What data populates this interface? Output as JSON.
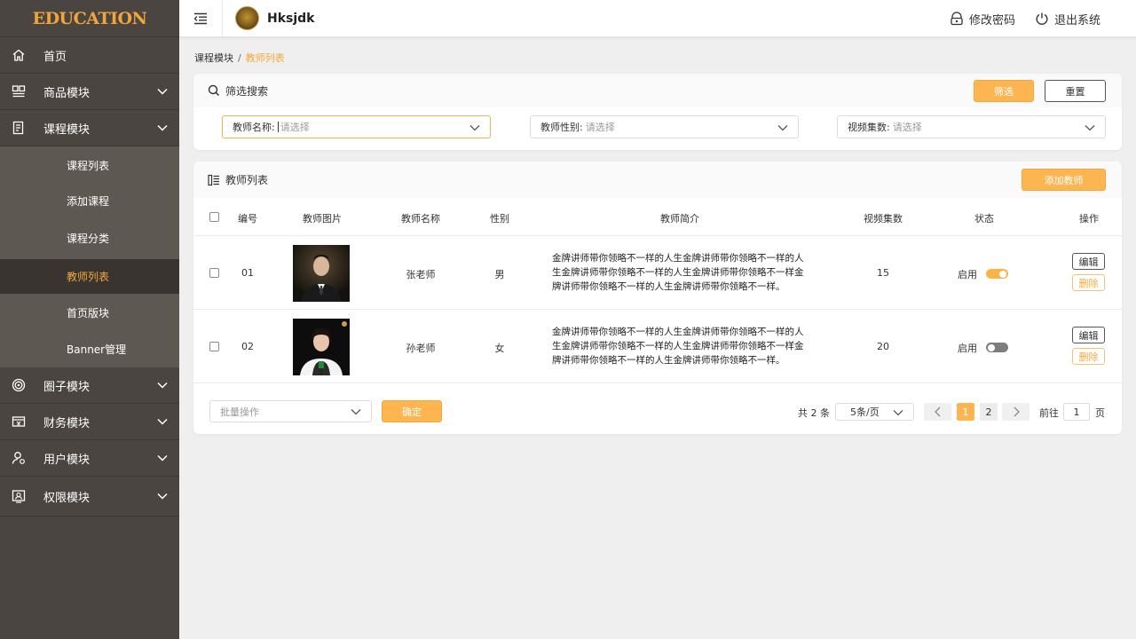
{
  "sidebar": {
    "logo": "EDUCATION",
    "menu": [
      {
        "label": "首页",
        "icon": "home-icon"
      },
      {
        "label": "商品模块",
        "icon": "goods-icon"
      },
      {
        "label": "课程模块",
        "icon": "course-icon"
      },
      {
        "label": "圈子模块",
        "icon": "circle-icon"
      },
      {
        "label": "财务模块",
        "icon": "finance-icon"
      },
      {
        "label": "用户模块",
        "icon": "user-icon"
      },
      {
        "label": "权限模块",
        "icon": "permission-icon"
      }
    ],
    "course_submenu": [
      "课程列表",
      "添加课程",
      "课程分类",
      "教师列表",
      "首页版块",
      "Banner管理"
    ],
    "active_submenu": "教师列表"
  },
  "header": {
    "username": "Hksjdk",
    "change_password": "修改密码",
    "logout": "退出系统"
  },
  "breadcrumb": {
    "parent": "课程模块",
    "separator": "/",
    "current": "教师列表"
  },
  "filter": {
    "title": "筛选搜索",
    "filter_button": "筛选",
    "reset_button": "重置",
    "fields": [
      {
        "label": "教师名称:",
        "placeholder": "请选择"
      },
      {
        "label": "教师性别:",
        "placeholder": "请选择"
      },
      {
        "label": "视频集数:",
        "placeholder": "请选择"
      }
    ]
  },
  "table": {
    "title": "教师列表",
    "add_button": "添加教师",
    "columns": [
      "编号",
      "教师图片",
      "教师名称",
      "性别",
      "教师简介",
      "视频集数",
      "状态",
      "操作"
    ],
    "rows": [
      {
        "id": "01",
        "name": "张老师",
        "gender": "男",
        "intro": "金牌讲师带你领略不一样的人生金牌讲师带你领略不一样的人生金牌讲师带你领略不一样的人生金牌讲师带你领略不一样金牌讲师带你领略不一样的人生金牌讲师带你领略不一样。",
        "videos": "15",
        "status_label": "启用",
        "enabled": true,
        "edit": "编辑",
        "delete": "删除"
      },
      {
        "id": "02",
        "name": "孙老师",
        "gender": "女",
        "intro": "金牌讲师带你领略不一样的人生金牌讲师带你领略不一样的人生金牌讲师带你领略不一样的人生金牌讲师带你领略不一样金牌讲师带你领略不一样的人生金牌讲师带你领略不一样。",
        "videos": "20",
        "status_label": "启用",
        "enabled": false,
        "edit": "编辑",
        "delete": "删除"
      }
    ]
  },
  "footer": {
    "batch_placeholder": "批量操作",
    "confirm_button": "确定",
    "total": "共 2 条",
    "page_size": "5条/页",
    "pages": [
      "1",
      "2"
    ],
    "current_page": "1",
    "goto_prefix": "前往",
    "goto_value": "1",
    "goto_suffix": "页"
  },
  "colors": {
    "accent": "#f5a73a",
    "sidebar": "#4a4541",
    "sidebar_active": "#393430"
  }
}
